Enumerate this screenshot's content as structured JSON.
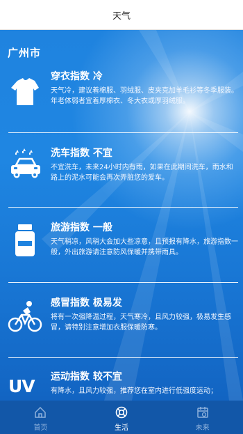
{
  "header": {
    "title": "天气"
  },
  "city": "广州市",
  "items": [
    {
      "title": "穿衣指数 冷",
      "desc": "天气冷，建议着棉服、羽绒服、皮夹克加羊毛衫等冬季服装。年老体弱者宜着厚棉衣、冬大衣或厚羽绒服。",
      "icon": "tshirt-icon"
    },
    {
      "title": "洗车指数 不宜",
      "desc": "不宜洗车，未来24小时内有雨，如果在此期间洗车，雨水和路上的泥水可能会再次弄脏您的爱车。",
      "icon": "car-wash-icon"
    },
    {
      "title": "旅游指数 一般",
      "desc": "天气稍凉，风稍大会加大些凉意，且预报有降水，旅游指数一般，外出旅游请注意防风保暖并携带雨具。",
      "icon": "medicine-bottle-icon"
    },
    {
      "title": "感冒指数 极易发",
      "desc": "将有一次强降温过程，天气寒冷，且风力较强，极易发生感冒，请特别注意增加衣服保暖防寒。",
      "icon": "cyclist-icon"
    },
    {
      "title": "运动指数 较不宜",
      "desc": "有降水，且风力较强，推荐您在室内进行低强度运动；",
      "icon": "uv-icon",
      "icon_text": "UV"
    }
  ],
  "tabs": [
    {
      "label": "首页",
      "icon": "home-icon",
      "active": false
    },
    {
      "label": "生活",
      "icon": "lifebuoy-icon",
      "active": true
    },
    {
      "label": "未来",
      "icon": "calendar-icon",
      "active": false
    }
  ],
  "colors": {
    "background_top": "#1f83df",
    "background_bottom": "#1264c2",
    "tabbar": "#1257a8",
    "text": "#ffffff"
  }
}
